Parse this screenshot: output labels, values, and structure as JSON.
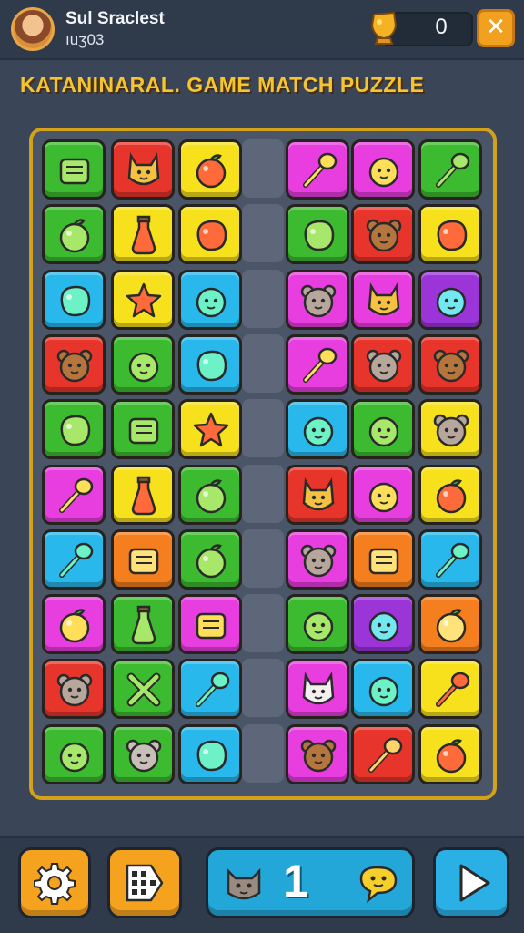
{
  "player": {
    "name": "Sul Sraclest",
    "subtitle": "ıuʒ03"
  },
  "coins": {
    "value": "0"
  },
  "title": "KATANINARAL. GAME MATCH PUZZLE",
  "colors": {
    "green": "#3dbb30",
    "red": "#e8352b",
    "yellow": "#f7e11c",
    "magenta": "#e83ee0",
    "cyan": "#28b8ec",
    "orange": "#f57f1f",
    "purple": "#9b35d8",
    "board_border": "#d4a21a"
  },
  "board": {
    "left_columns": [
      [
        {
          "color": "green",
          "icon": "carrot-box-icon"
        },
        {
          "color": "red",
          "icon": "cat-face-icon"
        },
        {
          "color": "yellow",
          "icon": "candy-bar-icon"
        }
      ],
      [
        {
          "color": "green",
          "icon": "apple-icon"
        },
        {
          "color": "yellow",
          "icon": "bottle-icon"
        },
        {
          "color": "yellow",
          "icon": "speech-bubble-icon"
        }
      ],
      [
        {
          "color": "cyan",
          "icon": "leaf-icon"
        },
        {
          "color": "yellow",
          "icon": "star-blob-icon"
        },
        {
          "color": "cyan",
          "icon": "slime-face-icon"
        }
      ],
      [
        {
          "color": "red",
          "icon": "bear-face-icon"
        },
        {
          "color": "green",
          "icon": "ghost-icon"
        },
        {
          "color": "cyan",
          "icon": "eggplant-icon"
        }
      ],
      [
        {
          "color": "green",
          "icon": "yarn-ball-icon"
        },
        {
          "color": "green",
          "icon": "pouch-icon"
        },
        {
          "color": "yellow",
          "icon": "star-icon"
        }
      ],
      [
        {
          "color": "magenta",
          "icon": "torch-icon"
        },
        {
          "color": "yellow",
          "icon": "flask-icon"
        },
        {
          "color": "green",
          "icon": "strawberry-icon"
        }
      ],
      [
        {
          "color": "cyan",
          "icon": "broom-icon"
        },
        {
          "color": "orange",
          "icon": "scroll-icon"
        },
        {
          "color": "green",
          "icon": "tomato-icon"
        }
      ],
      [
        {
          "color": "magenta",
          "icon": "heart-apple-icon"
        },
        {
          "color": "green",
          "icon": "potion-bottle-icon"
        },
        {
          "color": "magenta",
          "icon": "sailboat-icon"
        }
      ],
      [
        {
          "color": "red",
          "icon": "mouse-face-icon"
        },
        {
          "color": "green",
          "icon": "crossed-bones-icon"
        },
        {
          "color": "cyan",
          "icon": "battery-icon"
        }
      ],
      [
        {
          "color": "green",
          "icon": "chat-face-icon"
        },
        {
          "color": "green",
          "icon": "bug-face-icon"
        },
        {
          "color": "cyan",
          "icon": "corn-icon"
        }
      ]
    ],
    "right_columns": [
      [
        {
          "color": "magenta",
          "icon": "pill-icon"
        },
        {
          "color": "magenta",
          "icon": "shield-face-icon"
        },
        {
          "color": "green",
          "icon": "lollipop-icon"
        }
      ],
      [
        {
          "color": "green",
          "icon": "eggplant-icon"
        },
        {
          "color": "red",
          "icon": "bear-face-icon"
        },
        {
          "color": "yellow",
          "icon": "cloud-icon"
        }
      ],
      [
        {
          "color": "magenta",
          "icon": "mouse-face-icon"
        },
        {
          "color": "magenta",
          "icon": "cat-face-icon"
        },
        {
          "color": "purple",
          "icon": "monster-face-icon"
        }
      ],
      [
        {
          "color": "magenta",
          "icon": "pill-icon"
        },
        {
          "color": "red",
          "icon": "mouse-face-icon"
        },
        {
          "color": "red",
          "icon": "bear-face-icon"
        }
      ],
      [
        {
          "color": "cyan",
          "icon": "ghost-icon"
        },
        {
          "color": "green",
          "icon": "sun-face-icon"
        },
        {
          "color": "yellow",
          "icon": "mouse-face-icon"
        }
      ],
      [
        {
          "color": "red",
          "icon": "cat-face-icon"
        },
        {
          "color": "magenta",
          "icon": "sun-face-icon"
        },
        {
          "color": "yellow",
          "icon": "candy-icon"
        }
      ],
      [
        {
          "color": "magenta",
          "icon": "mouse-face-icon"
        },
        {
          "color": "orange",
          "icon": "puzzle-icon"
        },
        {
          "color": "cyan",
          "icon": "lollipop-icon"
        }
      ],
      [
        {
          "color": "green",
          "icon": "chat-face-icon"
        },
        {
          "color": "purple",
          "icon": "frog-face-icon"
        },
        {
          "color": "orange",
          "icon": "tomato-icon"
        }
      ],
      [
        {
          "color": "magenta",
          "icon": "bunny-face-icon"
        },
        {
          "color": "cyan",
          "icon": "fish-face-icon"
        },
        {
          "color": "yellow",
          "icon": "matchstick-icon"
        }
      ],
      [
        {
          "color": "magenta",
          "icon": "bear-face-icon"
        },
        {
          "color": "red",
          "icon": "rocket-icon"
        },
        {
          "color": "yellow",
          "icon": "plum-icon"
        }
      ]
    ]
  },
  "bottom": {
    "counter_value": "1",
    "settings_icon": "gear-icon",
    "grid_icon": "grid-tag-icon",
    "play_icon": "play-icon"
  }
}
